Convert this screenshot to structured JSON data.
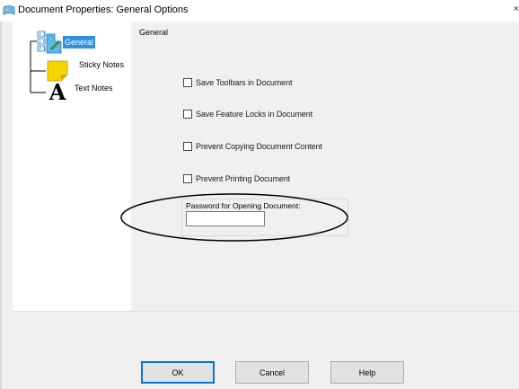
{
  "window": {
    "title": "Document Properties: General Options",
    "close_glyph": "×"
  },
  "tree": {
    "items": [
      {
        "label": "General",
        "icon": "general-options-icon",
        "selected": true
      },
      {
        "label": "Sticky Notes",
        "icon": "sticky-note-icon",
        "selected": false
      },
      {
        "label": "Text Notes",
        "icon": "text-note-icon",
        "selected": false
      }
    ]
  },
  "panel": {
    "group_label": "General",
    "checkboxes": [
      {
        "label": "Save Toolbars in Document",
        "checked": false
      },
      {
        "label": "Save Feature Locks in Document",
        "checked": false
      },
      {
        "label": "Prevent Copying Document Content",
        "checked": false
      },
      {
        "label": "Prevent Printing Document",
        "checked": false
      }
    ],
    "password": {
      "label": "Password for Opening Document:",
      "value": ""
    }
  },
  "buttons": {
    "ok": "OK",
    "cancel": "Cancel",
    "help": "Help"
  },
  "colors": {
    "selection": "#2f8fe0",
    "default_button_border": "#0078d7",
    "sticky_note": "#f5d400"
  }
}
